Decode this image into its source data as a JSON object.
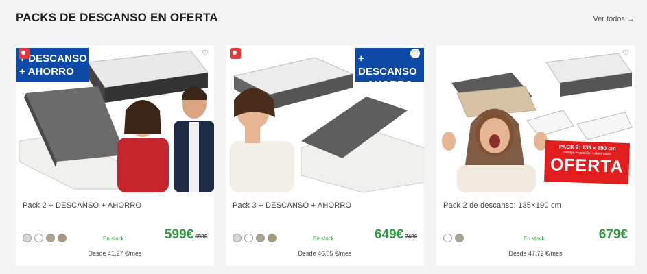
{
  "section": {
    "title": "PACKS DE DESCANSO EN OFERTA",
    "see_all": "Ver todos →"
  },
  "products": [
    {
      "promo_line1": "+ DESCANSO",
      "promo_line2": "+ AHORRO",
      "name": "Pack 2 + DESCANSO + AHORRO",
      "stock": "En stock",
      "price": "599€",
      "old_price": "698€",
      "monthly": "Desde 41,27 €/mes",
      "swatches": [
        "#d7d7d7",
        "#ffffff",
        "#a8a48e",
        "#a8997b"
      ]
    },
    {
      "promo_line1": "+ DESCANSO",
      "promo_line2": "+ AHORRO",
      "name": "Pack 3 + DESCANSO + AHORRO",
      "stock": "En stock",
      "price": "649€",
      "old_price": "748€",
      "monthly": "Desde 46,05 €/mes",
      "swatches": [
        "#d7d7d7",
        "#ffffff",
        "#a8a48e",
        "#a8997b"
      ]
    },
    {
      "oferta_line1": "PACK 2: 135 x 190 cm",
      "oferta_line2": "canapé + colchón + almohadas",
      "oferta_big": "OFERTA",
      "name": "Pack 2 de descanso: 135×190 cm",
      "stock": "En stock",
      "price": "679€",
      "monthly": "Desde 47,72 €/mes",
      "swatches": [
        "#ffffff",
        "#a8a48e"
      ]
    }
  ],
  "icons": {
    "tag": "tag-icon",
    "heart": "heart-icon"
  },
  "colors": {
    "price_green": "#2e9b3e",
    "promo_blue": "#0d4aa6",
    "oferta_red": "#e21d1d"
  }
}
